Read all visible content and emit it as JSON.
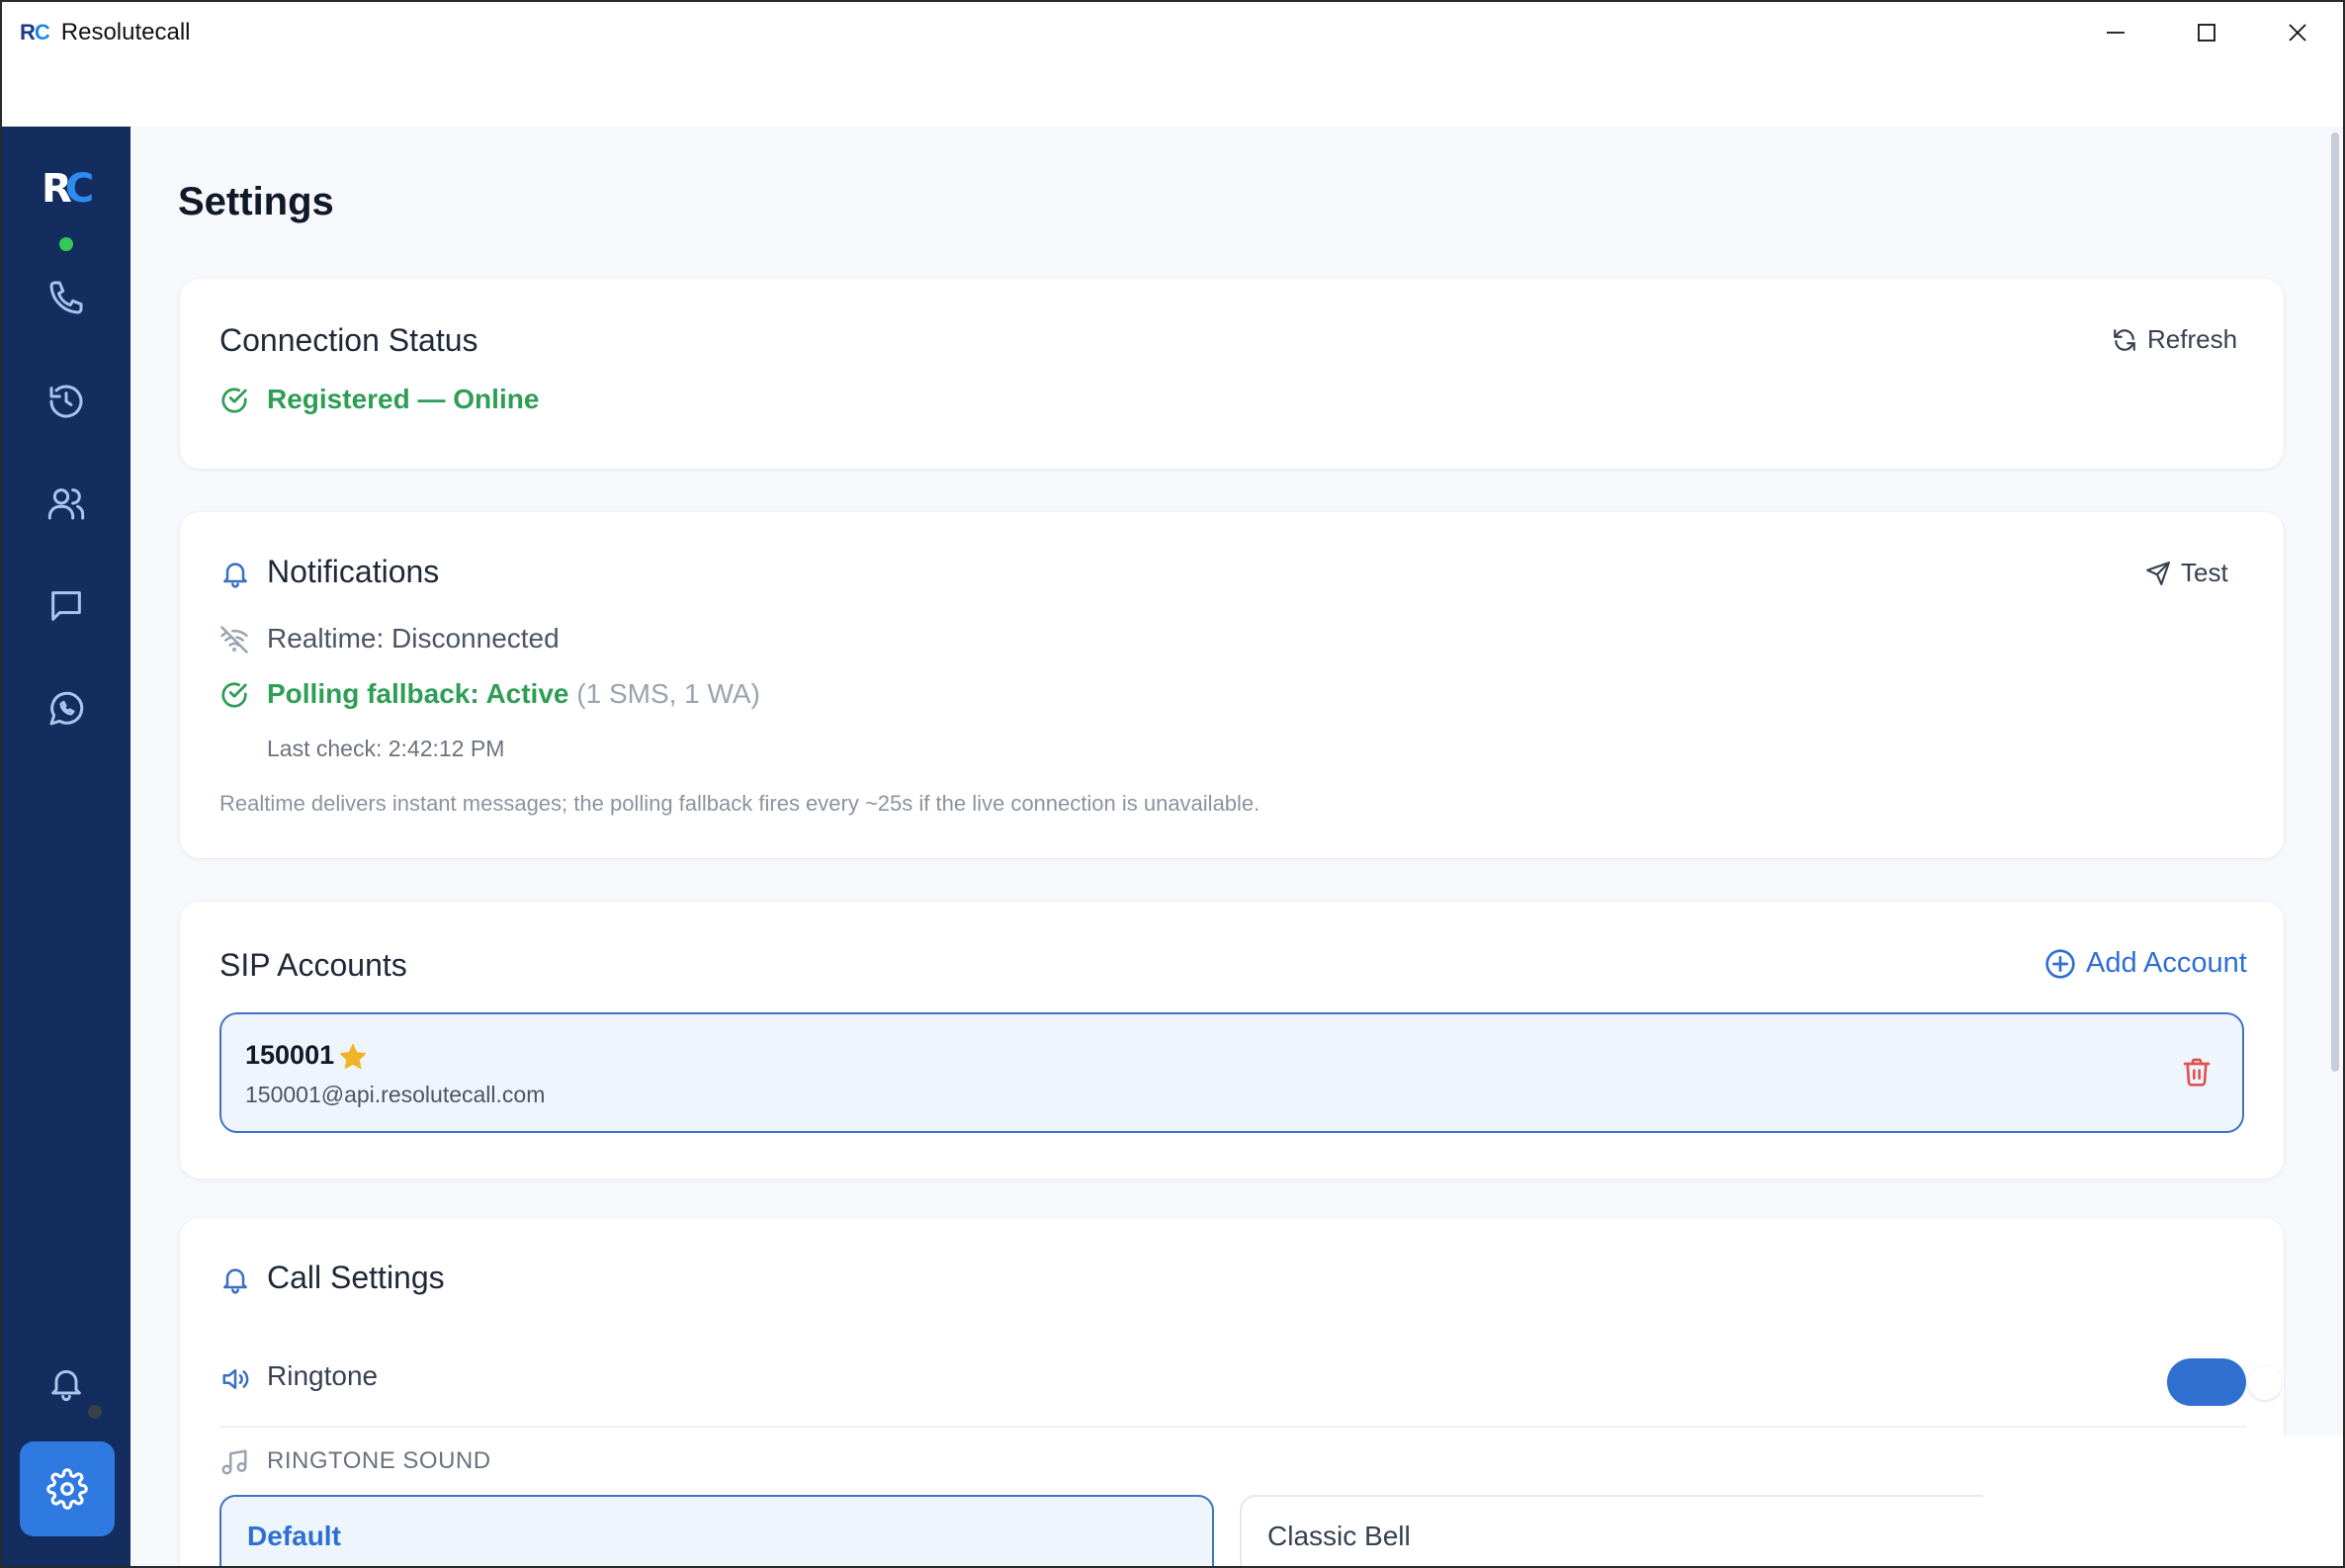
{
  "window": {
    "logo_r": "R",
    "logo_c": "C",
    "title": "Resolutecall"
  },
  "sidebar": {
    "brand_r": "R",
    "brand_c": "C",
    "items": [
      {
        "name": "phone",
        "icon": "phone-icon"
      },
      {
        "name": "history",
        "icon": "history-icon"
      },
      {
        "name": "contacts",
        "icon": "users-icon"
      },
      {
        "name": "messages",
        "icon": "message-icon"
      },
      {
        "name": "whatsapp",
        "icon": "whatsapp-icon"
      },
      {
        "name": "notifications",
        "icon": "bell-icon"
      },
      {
        "name": "settings",
        "icon": "gear-icon",
        "active": true
      }
    ]
  },
  "page": {
    "title": "Settings"
  },
  "connection": {
    "title": "Connection Status",
    "status": "Registered — Online",
    "refresh_label": "Refresh"
  },
  "notifications": {
    "title": "Notifications",
    "test_label": "Test",
    "realtime": "Realtime: Disconnected",
    "polling_label": "Polling fallback: Active",
    "polling_detail": "(1 SMS, 1 WA)",
    "last_check": "Last check: 2:42:12 PM",
    "description": "Realtime delivers instant messages; the polling fallback fires every ~25s if the live connection is unavailable."
  },
  "sip": {
    "title": "SIP Accounts",
    "add_label": "Add Account",
    "accounts": [
      {
        "number": "150001",
        "address": "150001@api.resolutecall.com",
        "default": true
      }
    ]
  },
  "call_settings": {
    "title": "Call Settings",
    "ringtone_label": "Ringtone",
    "ringtone_enabled": true,
    "ringtone_sound_label": "RINGTONE SOUND",
    "sounds": [
      {
        "label": "Default",
        "selected": true
      },
      {
        "label": "Classic Bell",
        "selected": false
      }
    ]
  },
  "colors": {
    "sidebar": "#132d5e",
    "accent": "#2e7ae0",
    "success": "#2f9e55",
    "danger": "#e05252",
    "star": "#f0b429"
  }
}
